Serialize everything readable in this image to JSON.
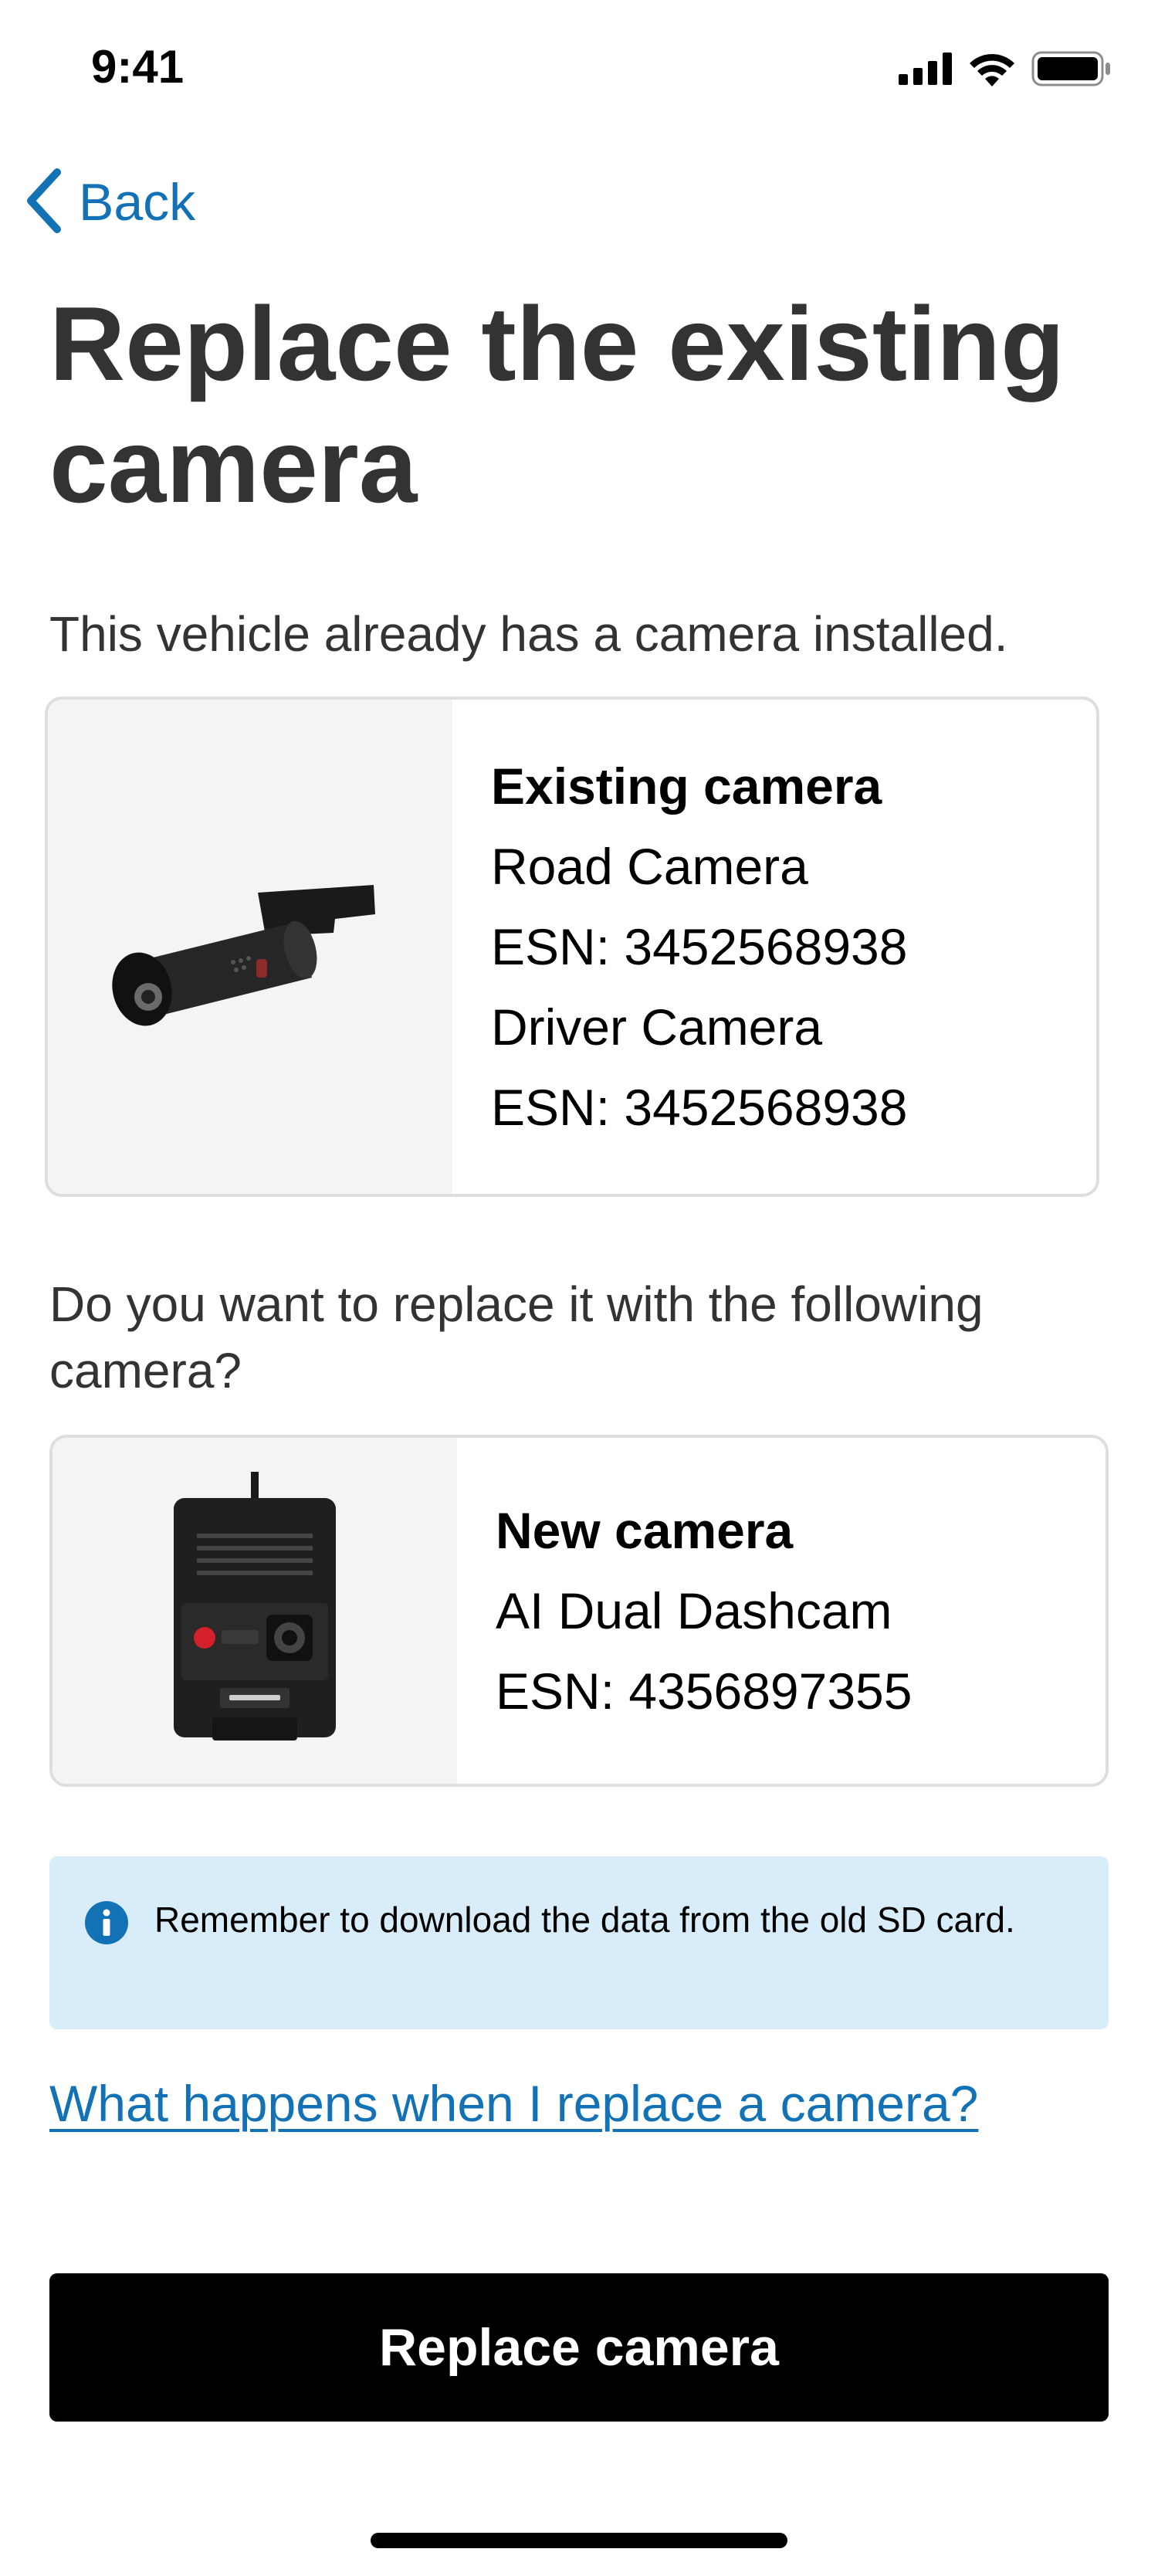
{
  "status_bar": {
    "time": "9:41",
    "icons": [
      "cellular-signal-icon",
      "wifi-icon",
      "battery-icon"
    ]
  },
  "nav": {
    "back_label": "Back",
    "back_icon": "chevron-left-icon"
  },
  "page": {
    "title": "Replace the existing camera",
    "intro": "This vehicle already has a camera installed.",
    "question": "Do you want to replace it with the following camera?"
  },
  "existing_camera": {
    "heading": "Existing camera",
    "lines": [
      "Road Camera",
      "ESN: 3452568938",
      "Driver Camera",
      "ESN: 3452568938"
    ]
  },
  "new_camera": {
    "heading": "New camera",
    "lines": [
      "AI Dual Dashcam",
      "ESN: 4356897355"
    ]
  },
  "info_banner": {
    "icon": "info-icon",
    "text": "Remember to download the data from the old SD card."
  },
  "help_link": "What happens when I replace a camera?",
  "primary_button": "Replace camera",
  "colors": {
    "link_blue": "#1372b6",
    "info_bg": "#d9ecf9",
    "title_text": "#333333",
    "button_bg": "#000000"
  }
}
